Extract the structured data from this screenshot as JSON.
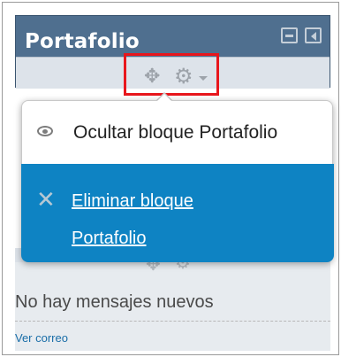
{
  "block": {
    "title": "Portafolio",
    "header_buttons": [
      "minimize-icon",
      "dock-icon"
    ],
    "controls_icons": [
      "move-icon",
      "gear-icon",
      "caret-down-icon"
    ]
  },
  "menu": {
    "hide_label": "Ocultar bloque Portafolio",
    "delete_label_line1": "Eliminar bloque",
    "delete_label_line2": "Portafolio",
    "icons": [
      "eye-icon",
      "x-icon"
    ]
  },
  "messages": {
    "status_text": "No hay mensajes nuevos",
    "mail_link": "Ver correo"
  },
  "colors": {
    "header_bg": "#4f6f8f",
    "menu_highlight": "#0e83c3",
    "annotation_box": "#e8161c"
  }
}
